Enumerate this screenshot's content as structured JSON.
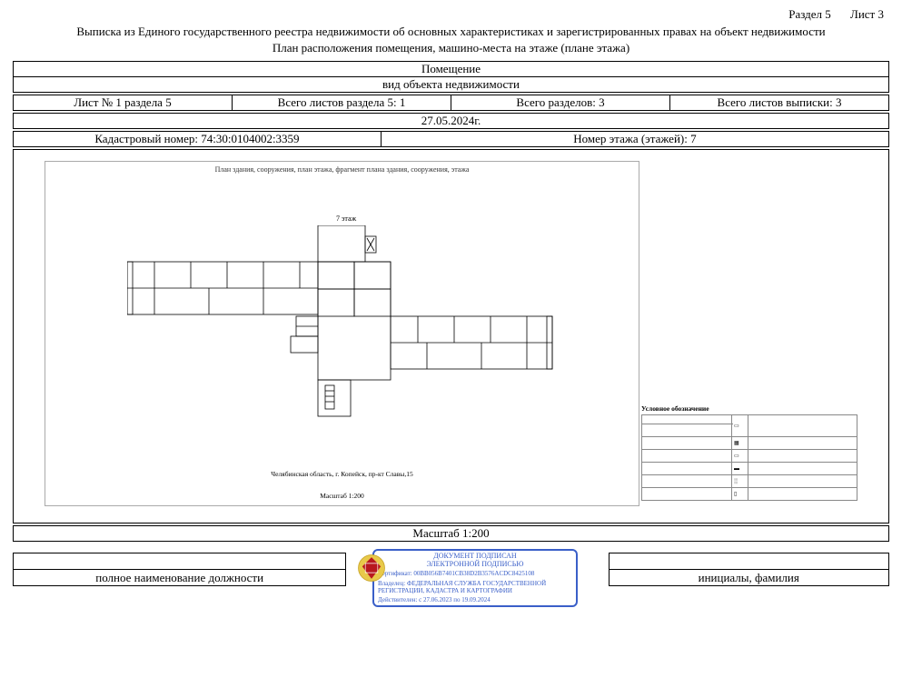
{
  "header": {
    "section": "Раздел 5",
    "sheet": "Лист 3",
    "title_line1": "Выписка из Единого государственного реестра недвижимости об основных характеристиках и зарегистрированных правах на объект недвижимости",
    "title_line2": "План расположения помещения, машино-места на этаже (плане этажа)"
  },
  "object": {
    "object_name": "Помещение",
    "object_type_label": "вид объекта недвижимости"
  },
  "counts": {
    "sheet_of_section": "Лист № 1 раздела 5",
    "total_sheets_section": "Всего листов раздела 5: 1",
    "total_sections": "Всего разделов: 3",
    "total_sheets_extract": "Всего листов выписки: 3"
  },
  "meta": {
    "date": "27.05.2024г.",
    "cadastral_label": "Кадастровый номер: 74:30:0104002:3359",
    "floor_label": "Номер этажа (этажей): 7"
  },
  "plan": {
    "top_caption": "План здания, сооружения, план этажа, фрагмент плана здания, сооружения, этажа",
    "floor_label": "7 этаж",
    "address": "Челябинская область, г. Копейск,  пр-кт Славы,15",
    "scale_small": "Масштаб 1:200",
    "legend_title": "Условное обозначение"
  },
  "scale_line": "Масштаб 1:200",
  "signature": {
    "left_label": "полное наименование должности",
    "right_label": "инициалы, фамилия",
    "stamp": {
      "line1": "ДОКУМЕНТ ПОДПИСАН",
      "line2": "ЭЛЕКТРОННОЙ ПОДПИСЬЮ",
      "cert": "Сертификат: 00BB056B7401CB38D2B3576ACDC8425108",
      "owner": "Владелец: ФЕДЕРАЛЬНАЯ СЛУЖБА ГОСУДАРСТВЕННОЙ РЕГИСТРАЦИИ, КАДАСТРА И КАРТОГРАФИИ",
      "valid": "Действителен: с 27.06.2023 по 19.09.2024"
    }
  }
}
